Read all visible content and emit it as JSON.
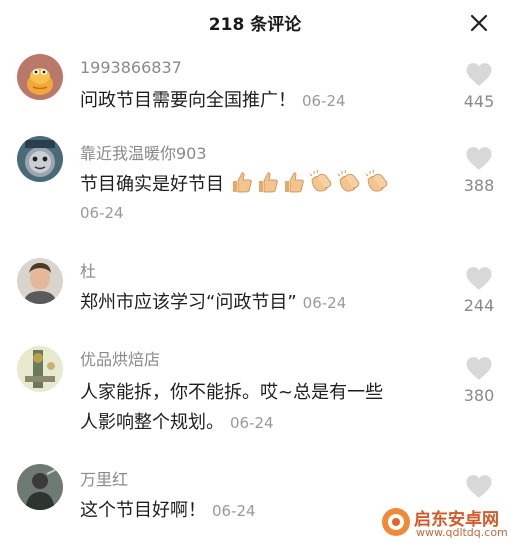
{
  "header": {
    "title": "218 条评论"
  },
  "comments": [
    {
      "username": "1993866837",
      "text": "问政节目需要向全国推广！",
      "date": "06-24",
      "likes": "445"
    },
    {
      "username": "靠近我温暖你903",
      "text": "节目确实是好节目",
      "date": "06-24",
      "likes": "388",
      "emojis": [
        "thumbs-up-icon",
        "thumbs-up-icon",
        "thumbs-up-icon",
        "clapping-hands-icon",
        "clapping-hands-icon",
        "clapping-hands-icon"
      ]
    },
    {
      "username": "杜",
      "text": "郑州市应该学习“问政节目”",
      "date": "06-24",
      "likes": "244"
    },
    {
      "username": "优品烘焙店",
      "text_line1": "人家能拆，你不能拆。哎~总是有一些",
      "text_line2": "人影响整个规划。",
      "date": "06-24",
      "likes": "380"
    },
    {
      "username": "万里红",
      "text": "这个节目好啊！",
      "date": "06-24",
      "likes": ""
    }
  ],
  "watermark": {
    "brand": "启东安卓网",
    "url": "www.qdltdq.com"
  },
  "colors": {
    "muted_text": "#8a8a8a",
    "like_icon": "#d8d8d8",
    "watermark": "#d25a2a"
  }
}
